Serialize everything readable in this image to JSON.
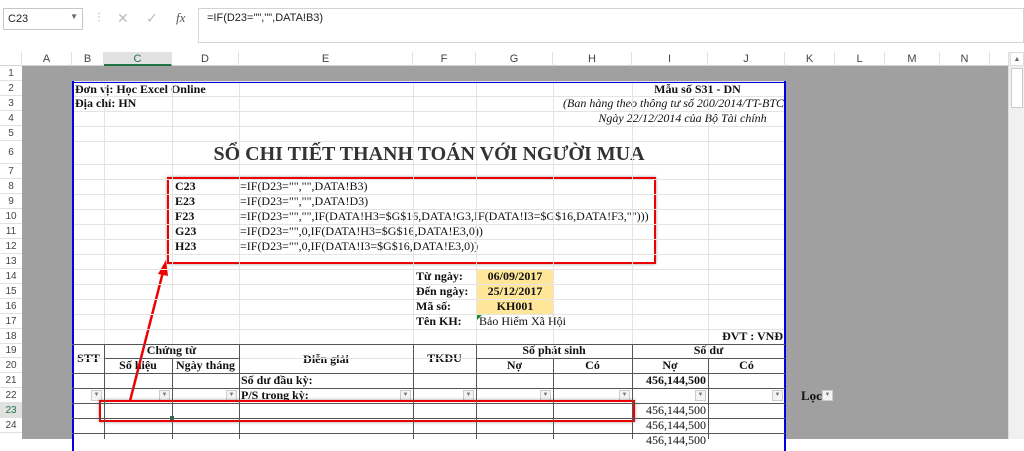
{
  "formula_bar": {
    "name_box": "C23",
    "cancel_icon": "✕",
    "enter_icon": "✓",
    "fx_label": "fx",
    "formula": "=IF(D23=\"\",\"\",DATA!B3)"
  },
  "columns": [
    "A",
    "B",
    "C",
    "D",
    "E",
    "F",
    "G",
    "H",
    "I",
    "J",
    "K",
    "L",
    "M",
    "N"
  ],
  "rows": [
    "1",
    "2",
    "3",
    "4",
    "5",
    "6",
    "7",
    "8",
    "9",
    "10",
    "11",
    "12",
    "13",
    "14",
    "15",
    "16",
    "17",
    "18",
    "19",
    "20",
    "21",
    "22",
    "23",
    "24"
  ],
  "selected_cell": "C23",
  "colors": {
    "page_border": "#0000e0",
    "annotation": "#e00000",
    "highlight": "#ffe699",
    "grey_area": "#a0a0a0",
    "selection": "#217346"
  },
  "sheet": {
    "unit_name": "Đơn vị: Học Excel Online",
    "address": "Địa chỉ: HN",
    "form_no": "Mẫu số S31 - DN",
    "circular": "(Ban hàng theo thông tư số 200/2014/TT-BTC",
    "circular_date": "Ngày 22/12/2014 của Bộ Tài chính",
    "title": "SỔ CHI TIẾT THANH TOÁN VỚI NGƯỜI MUA",
    "formulas": [
      {
        "cell": "C23",
        "formula": "=IF(D23=\"\",\"\",DATA!B3)"
      },
      {
        "cell": "E23",
        "formula": "=IF(D23=\"\",\"\",DATA!D3)"
      },
      {
        "cell": "F23",
        "formula": "=IF(D23=\"\",\"\",IF(DATA!H3=$G$16,DATA!G3,IF(DATA!I3=$G$16,DATA!F3,\"\")))"
      },
      {
        "cell": "G23",
        "formula": "=IF(D23=\"\",0,IF(DATA!H3=$G$16,DATA!E3,0))"
      },
      {
        "cell": "H23",
        "formula": "=IF(D23=\"\",0,IF(DATA!I3=$G$16,DATA!E3,0))"
      }
    ],
    "from_label": "Từ ngày:",
    "from_value": "06/09/2017",
    "to_label": "Đến ngày:",
    "to_value": "25/12/2017",
    "code_label": "Mã số:",
    "code_value": "KH001",
    "customer_label": "Tên KH:",
    "customer_value": "Bảo Hiểm Xã Hội",
    "unit_note": "ĐVT : VNĐ",
    "table": {
      "stt": "STT",
      "voucher": "Chứng từ",
      "voucher_no": "Số hiệu",
      "voucher_date": "Ngày tháng",
      "description": "Diễn giải",
      "account": "TKDU",
      "movement": "Số phát sinh",
      "debit": "Nợ",
      "credit": "Có",
      "balance": "Số dư",
      "balance_debit": "Nợ",
      "balance_credit": "Có",
      "opening_label": "Số dư đầu kỳ:",
      "opening_balance": "456,144,500",
      "period_label": "P/S trong kỳ:",
      "rows": [
        {
          "balance_debit": "456,144,500"
        },
        {
          "balance_debit": "456,144,500"
        },
        {
          "balance_debit": "456,144,500"
        }
      ]
    },
    "filter_label": "Lọc"
  }
}
